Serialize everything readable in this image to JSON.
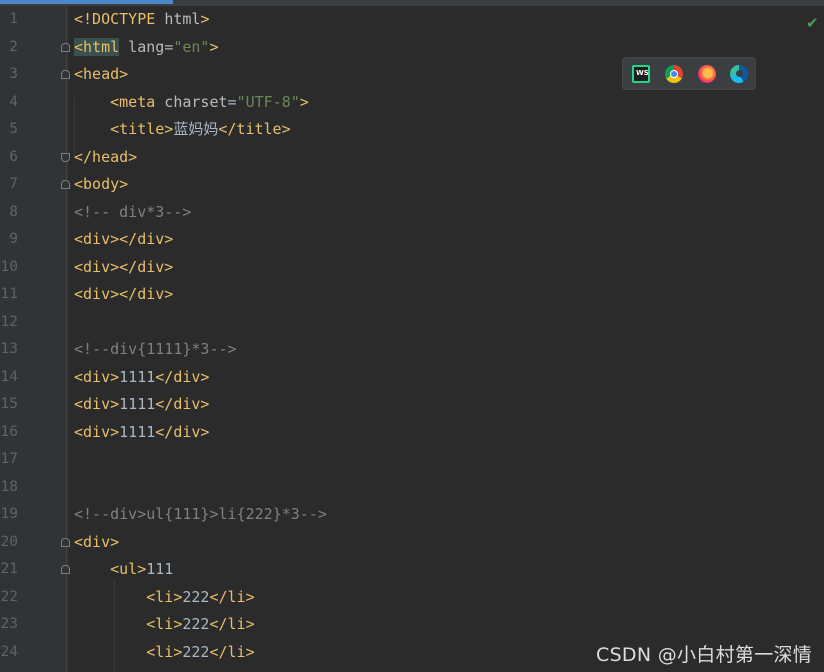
{
  "editor": {
    "lines": [
      {
        "num": "1",
        "tokens": [
          {
            "k": "t",
            "v": "<!DOCTYPE "
          },
          {
            "k": "a",
            "v": "html"
          },
          {
            "k": "t",
            "v": ">"
          }
        ]
      },
      {
        "num": "2",
        "fold": "open",
        "tokens": [
          {
            "k": "t",
            "v": "<html",
            "hl": true
          },
          {
            "k": "a",
            "v": " lang"
          },
          {
            "k": "p",
            "v": "="
          },
          {
            "k": "s",
            "v": "\"en\""
          },
          {
            "k": "t",
            "v": ">"
          }
        ]
      },
      {
        "num": "3",
        "fold": "open",
        "tokens": [
          {
            "k": "t",
            "v": "<head>"
          }
        ]
      },
      {
        "num": "4",
        "tokens": [
          {
            "k": "p",
            "v": "    "
          },
          {
            "k": "t",
            "v": "<meta"
          },
          {
            "k": "a",
            "v": " charset"
          },
          {
            "k": "p",
            "v": "="
          },
          {
            "k": "s",
            "v": "\"UTF-8\""
          },
          {
            "k": "t",
            "v": ">"
          }
        ]
      },
      {
        "num": "5",
        "tokens": [
          {
            "k": "p",
            "v": "    "
          },
          {
            "k": "t",
            "v": "<title>"
          },
          {
            "k": "p",
            "v": "蓝妈妈"
          },
          {
            "k": "t",
            "v": "</title>"
          }
        ]
      },
      {
        "num": "6",
        "fold": "close",
        "tokens": [
          {
            "k": "t",
            "v": "</head>"
          }
        ]
      },
      {
        "num": "7",
        "fold": "open",
        "tokens": [
          {
            "k": "t",
            "v": "<body>"
          }
        ]
      },
      {
        "num": "8",
        "tokens": [
          {
            "k": "c",
            "v": "<!-- div*3-->"
          }
        ]
      },
      {
        "num": "9",
        "tokens": [
          {
            "k": "t",
            "v": "<div></div>"
          }
        ]
      },
      {
        "num": "10",
        "tokens": [
          {
            "k": "t",
            "v": "<div></div>"
          }
        ]
      },
      {
        "num": "11",
        "tokens": [
          {
            "k": "t",
            "v": "<div></div>"
          }
        ]
      },
      {
        "num": "12",
        "tokens": []
      },
      {
        "num": "13",
        "tokens": [
          {
            "k": "c",
            "v": "<!--div{1111}*3-->"
          }
        ]
      },
      {
        "num": "14",
        "tokens": [
          {
            "k": "t",
            "v": "<div>"
          },
          {
            "k": "p",
            "v": "1111"
          },
          {
            "k": "t",
            "v": "</div>"
          }
        ]
      },
      {
        "num": "15",
        "tokens": [
          {
            "k": "t",
            "v": "<div>"
          },
          {
            "k": "p",
            "v": "1111"
          },
          {
            "k": "t",
            "v": "</div>"
          }
        ]
      },
      {
        "num": "16",
        "tokens": [
          {
            "k": "t",
            "v": "<div>"
          },
          {
            "k": "p",
            "v": "1111"
          },
          {
            "k": "t",
            "v": "</div>"
          }
        ]
      },
      {
        "num": "17",
        "tokens": []
      },
      {
        "num": "18",
        "tokens": []
      },
      {
        "num": "19",
        "tokens": [
          {
            "k": "c",
            "v": "<!--div>ul{111}>li{222}*3-->"
          }
        ]
      },
      {
        "num": "20",
        "fold": "open",
        "tokens": [
          {
            "k": "t",
            "v": "<div>"
          }
        ]
      },
      {
        "num": "21",
        "fold": "open",
        "tokens": [
          {
            "k": "p",
            "v": "    "
          },
          {
            "k": "t",
            "v": "<ul>"
          },
          {
            "k": "p",
            "v": "111"
          }
        ]
      },
      {
        "num": "22",
        "tokens": [
          {
            "k": "p",
            "v": "        "
          },
          {
            "k": "t",
            "v": "<li>"
          },
          {
            "k": "p",
            "v": "222"
          },
          {
            "k": "t",
            "v": "</li>"
          }
        ]
      },
      {
        "num": "23",
        "tokens": [
          {
            "k": "p",
            "v": "        "
          },
          {
            "k": "t",
            "v": "<li>"
          },
          {
            "k": "p",
            "v": "222"
          },
          {
            "k": "t",
            "v": "</li>"
          }
        ]
      },
      {
        "num": "24",
        "tokens": [
          {
            "k": "p",
            "v": "        "
          },
          {
            "k": "t",
            "v": "<li>"
          },
          {
            "k": "p",
            "v": "222"
          },
          {
            "k": "t",
            "v": "</li>"
          }
        ]
      }
    ]
  },
  "status": {
    "check_icon": "check-icon",
    "check_glyph": "✔"
  },
  "browsers": [
    {
      "name": "webstorm-icon",
      "label": "WS"
    },
    {
      "name": "chrome-icon"
    },
    {
      "name": "firefox-icon"
    },
    {
      "name": "edge-icon"
    }
  ],
  "watermark": "CSDN @小白村第一深情",
  "colors": {
    "background": "#2b2b2b",
    "tag": "#e8bf6a",
    "attribute": "#bababa",
    "string": "#6a8759",
    "comment": "#808080",
    "text": "#a9b7c6",
    "line_number": "#606366",
    "accent": "#4a88c7"
  }
}
